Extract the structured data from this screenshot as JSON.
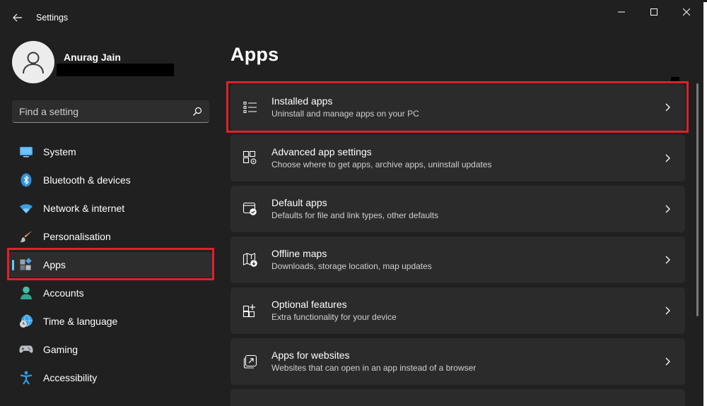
{
  "window": {
    "title": "Settings"
  },
  "user": {
    "name": "Anurag Jain"
  },
  "search": {
    "placeholder": "Find a setting"
  },
  "sidebar": {
    "items": [
      {
        "label": "System",
        "icon": "system-icon"
      },
      {
        "label": "Bluetooth & devices",
        "icon": "bluetooth-icon"
      },
      {
        "label": "Network & internet",
        "icon": "wifi-icon"
      },
      {
        "label": "Personalisation",
        "icon": "paintbrush-icon"
      },
      {
        "label": "Apps",
        "icon": "apps-icon",
        "selected": true
      },
      {
        "label": "Accounts",
        "icon": "accounts-icon"
      },
      {
        "label": "Time & language",
        "icon": "time-language-icon"
      },
      {
        "label": "Gaming",
        "icon": "gamepad-icon"
      },
      {
        "label": "Accessibility",
        "icon": "accessibility-icon"
      }
    ]
  },
  "main": {
    "title": "Apps",
    "cards": [
      {
        "title": "Installed apps",
        "desc": "Uninstall and manage apps on your PC",
        "icon": "list-icon"
      },
      {
        "title": "Advanced app settings",
        "desc": "Choose where to get apps, archive apps, uninstall updates",
        "icon": "app-settings-icon"
      },
      {
        "title": "Default apps",
        "desc": "Defaults for file and link types, other defaults",
        "icon": "default-apps-icon"
      },
      {
        "title": "Offline maps",
        "desc": "Downloads, storage location, map updates",
        "icon": "map-icon"
      },
      {
        "title": "Optional features",
        "desc": "Extra functionality for your device",
        "icon": "optional-features-icon"
      },
      {
        "title": "Apps for websites",
        "desc": "Websites that can open in an app instead of a browser",
        "icon": "open-external-icon"
      }
    ]
  },
  "colors": {
    "background": "#202020",
    "card": "#2b2b2b",
    "accent": "#60cdff",
    "highlight_outline": "#e0202a"
  }
}
